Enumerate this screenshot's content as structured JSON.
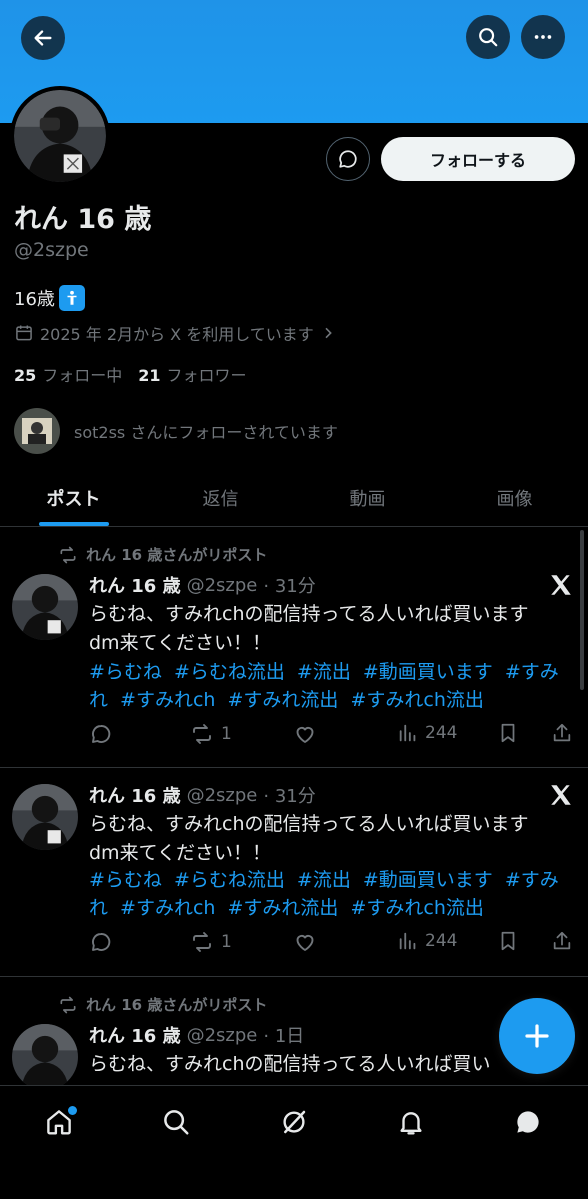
{
  "profile": {
    "name": "れん 16 歳",
    "handle": "@2szpe",
    "bio": "16歳",
    "joined": "2025 年 2月から X を利用しています",
    "following_count": "25",
    "following_label": "フォロー中",
    "followers_count": "21",
    "followers_label": "フォロワー",
    "followed_by": "sot2ss さんにフォローされています",
    "follow_button": "フォローする"
  },
  "tabs": [
    {
      "label": "ポスト",
      "active": true
    },
    {
      "label": "返信",
      "active": false
    },
    {
      "label": "動画",
      "active": false
    },
    {
      "label": "画像",
      "active": false
    }
  ],
  "posts": [
    {
      "repost_label": "れん 16 歳さんがリポスト",
      "name": "れん 16 歳",
      "handle": "@2szpe",
      "time": "· 31分",
      "text_line1": "らむね、すみれchの配信持ってる人いれば買います",
      "text_line2": "dm来てください！！",
      "hashtags_line1": "#らむね #らむね流出 #流出 #動画買います #すみ",
      "hashtags_line2": "れ #すみれch #すみれ流出 #すみれch流出",
      "retweets": "1",
      "views": "244"
    },
    {
      "name": "れん 16 歳",
      "handle": "@2szpe",
      "time": "· 31分",
      "text_line1": "らむね、すみれchの配信持ってる人いれば買います",
      "text_line2": "dm来てください！！",
      "hashtags_line1": "#らむね #らむね流出 #流出 #動画買います #すみ",
      "hashtags_line2": "れ #すみれch #すみれ流出 #すみれch流出",
      "retweets": "1",
      "views": "244"
    },
    {
      "repost_label": "れん 16 歳さんがリポスト",
      "name": "れん 16 歳",
      "handle": "@2szpe",
      "time": "· 1日",
      "text_line1": "らむね、すみれchの配信持ってる人いれば買い"
    }
  ],
  "colors": {
    "accent": "#1d9bf0",
    "background": "#000000",
    "muted": "#71767b",
    "text": "#e7e9ea"
  },
  "icons": {
    "back": "arrow-left-icon",
    "search": "search-icon",
    "more": "more-horizontal-icon",
    "dm": "message-icon",
    "calendar": "calendar-icon",
    "reply": "reply-icon",
    "retweet": "retweet-icon",
    "like": "heart-icon",
    "views": "views-icon",
    "bookmark": "bookmark-icon",
    "share": "share-icon",
    "compose": "plus-icon",
    "home": "home-icon",
    "explore": "search-icon",
    "grok": "grok-icon",
    "notifications": "bell-icon",
    "messages": "chat-bubble-icon"
  }
}
